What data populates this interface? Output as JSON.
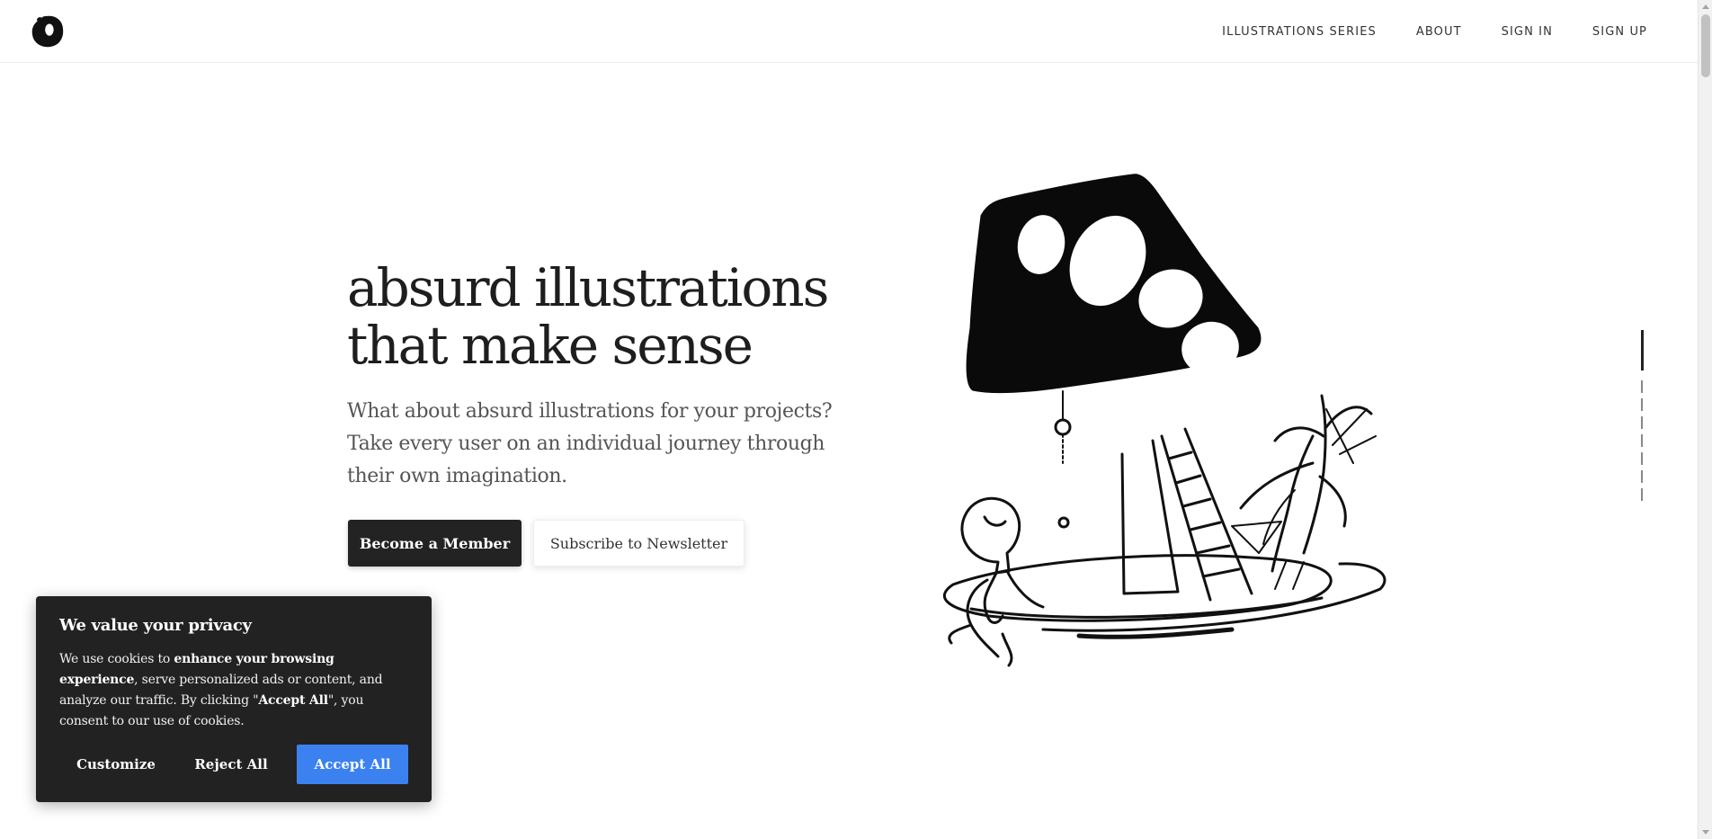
{
  "header": {
    "nav": [
      {
        "id": "series",
        "label": "ILLUSTRATIONS SERIES"
      },
      {
        "id": "about",
        "label": "ABOUT"
      },
      {
        "id": "signin",
        "label": "SIGN IN"
      },
      {
        "id": "signup",
        "label": "SIGN UP"
      }
    ]
  },
  "hero": {
    "title_line1": "absurd illustrations",
    "title_line2": "that make sense",
    "subtitle_line1": "What about absurd illustrations for your projects?",
    "subtitle_line2": "Take every user on an individual journey through",
    "subtitle_line3": "their own imagination.",
    "primary_button": "Become a Member",
    "secondary_button": "Subscribe to Newsletter"
  },
  "cookie": {
    "title": "We value your privacy",
    "text_1": "We use cookies to ",
    "text_bold_1": "enhance your browsing experience",
    "text_2": ", serve personalized ads or content, and analyze our traffic. By clicking \"",
    "text_bold_2": "Accept All",
    "text_3": "\", you consent to our use of cookies.",
    "customize": "Customize",
    "reject": "Reject All",
    "accept": "Accept All"
  },
  "colors": {
    "primary_button": "#232323",
    "accept_button": "#3b82f0",
    "cookie_bg": "#222222"
  },
  "icons": {
    "logo": "blob-logo-icon",
    "illustration": "mushroom-lamp-illustration"
  }
}
